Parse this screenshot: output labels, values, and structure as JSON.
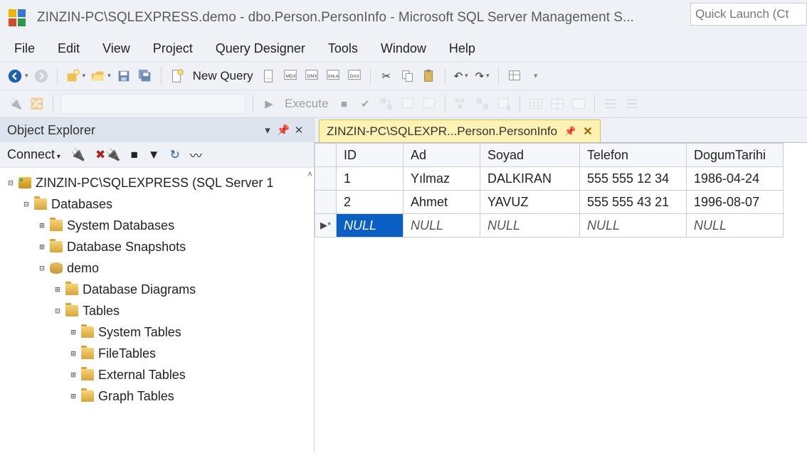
{
  "title": "ZINZIN-PC\\SQLEXPRESS.demo - dbo.Person.PersonInfo - Microsoft SQL Server Management S...",
  "quick_launch_placeholder": "Quick Launch (Ct",
  "menu": [
    "File",
    "Edit",
    "View",
    "Project",
    "Query Designer",
    "Tools",
    "Window",
    "Help"
  ],
  "toolbar1": {
    "new_query": "New Query"
  },
  "toolbar2": {
    "execute": "Execute"
  },
  "object_explorer": {
    "title": "Object Explorer",
    "connect": "Connect",
    "root": "ZINZIN-PC\\SQLEXPRESS (SQL Server 1",
    "nodes": {
      "databases": "Databases",
      "system_databases": "System Databases",
      "database_snapshots": "Database Snapshots",
      "demo": "demo",
      "database_diagrams": "Database Diagrams",
      "tables": "Tables",
      "system_tables": "System Tables",
      "file_tables": "FileTables",
      "external_tables": "External Tables",
      "graph_tables": "Graph Tables"
    }
  },
  "tab": {
    "label": "ZINZIN-PC\\SQLEXPR...Person.PersonInfo"
  },
  "grid": {
    "columns": [
      "ID",
      "Ad",
      "Soyad",
      "Telefon",
      "DogumTarihi"
    ],
    "rows": [
      {
        "ID": "1",
        "Ad": "Yılmaz",
        "Soyad": "DALKIRAN",
        "Telefon": "555 555 12 34",
        "DogumTarihi": "1986-04-24"
      },
      {
        "ID": "2",
        "Ad": "Ahmet",
        "Soyad": "YAVUZ",
        "Telefon": "555 555 43 21",
        "DogumTarihi": "1996-08-07"
      }
    ],
    "null": "NULL"
  }
}
